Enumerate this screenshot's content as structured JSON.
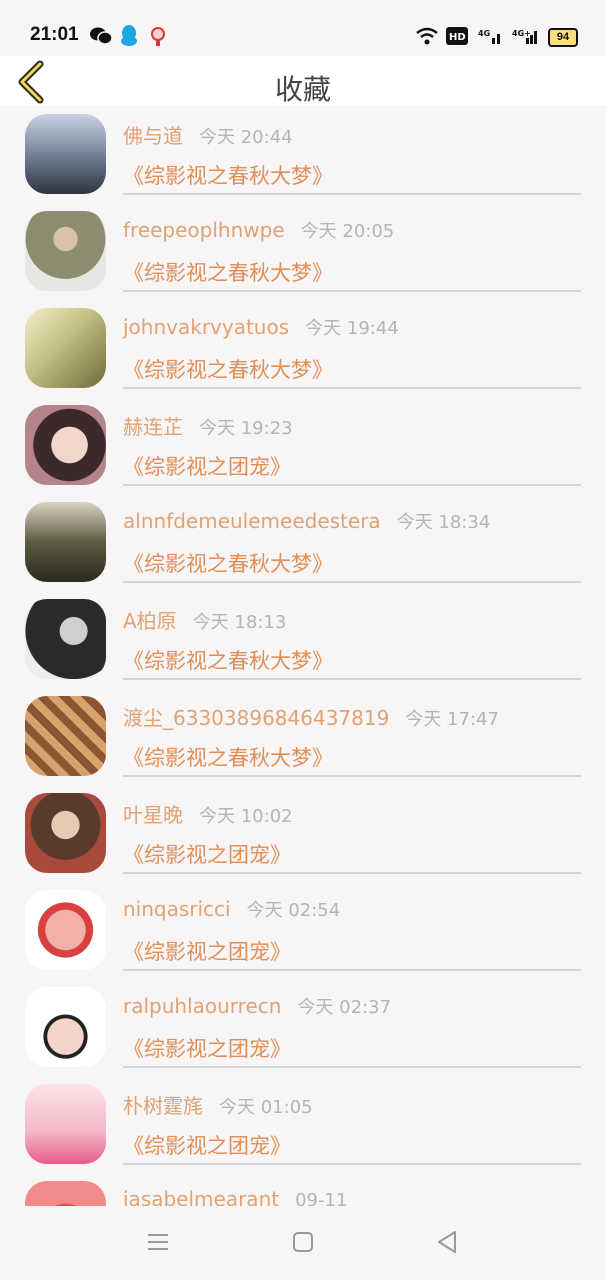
{
  "status": {
    "time": "21:01",
    "battery": "94"
  },
  "header": {
    "title": "收藏"
  },
  "items": [
    {
      "name": "佛与道",
      "time": "今天 20:44",
      "work": "《综影视之春秋大梦》",
      "avatar_color": "#7a8594"
    },
    {
      "name": "freepeoplhnwpe",
      "time": "今天 20:05",
      "work": "《综影视之春秋大梦》",
      "avatar_color": "#8a8b6f"
    },
    {
      "name": "johnvakrvyatuos",
      "time": "今天 19:44",
      "work": "《综影视之春秋大梦》",
      "avatar_color": "#c9c48a"
    },
    {
      "name": "赫连芷",
      "time": "今天 19:23",
      "work": "《综影视之团宠》",
      "avatar_color": "#b5838a"
    },
    {
      "name": "alnnfdemeulemeedestera",
      "time": "今天 18:34",
      "work": "《综影视之春秋大梦》",
      "avatar_color": "#6f6a52"
    },
    {
      "name": "A柏原",
      "time": "今天 18:13",
      "work": "《综影视之春秋大梦》",
      "avatar_color": "#888888"
    },
    {
      "name": "渡尘_63303896846437819",
      "time": "今天 17:47",
      "work": "《综影视之春秋大梦》",
      "avatar_color": "#7b4a2c"
    },
    {
      "name": "叶星晚",
      "time": "今天 10:02",
      "work": "《综影视之团宠》",
      "avatar_color": "#9e5a44"
    },
    {
      "name": "ninqasricci",
      "time": "今天 02:54",
      "work": "《综影视之团宠》",
      "avatar_color": "#e7a3a3"
    },
    {
      "name": "ralpuhlaourrecn",
      "time": "今天 02:37",
      "work": "《综影视之团宠》",
      "avatar_color": "#ecd9d4"
    },
    {
      "name": "朴树霆旄",
      "time": "今天 01:05",
      "work": "《综影视之团宠》",
      "avatar_color": "#f2b8c6"
    },
    {
      "name": "iasabelmearant",
      "time": "09-11",
      "work": "",
      "avatar_color": "#e05050"
    }
  ]
}
